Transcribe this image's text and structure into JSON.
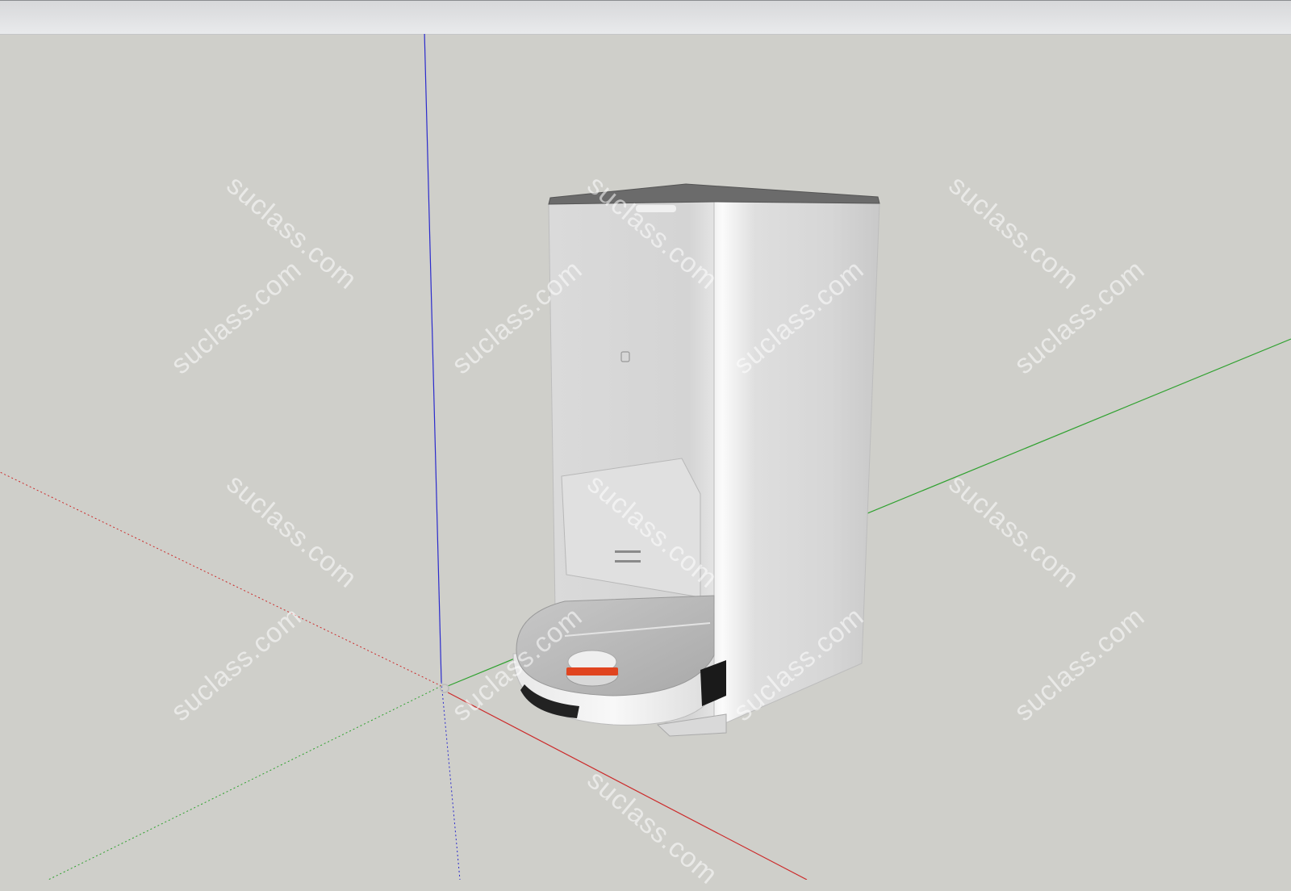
{
  "app": {
    "colors": {
      "background": "#cfcfca",
      "axis_red": "#cc2b2b",
      "axis_green": "#2fa12f",
      "axis_blue": "#2b2bcc",
      "accent_orange": "#e0441f"
    }
  },
  "scene": {
    "model": "robot-vacuum-with-auto-empty-station"
  },
  "watermarks": [
    {
      "text": "suclass.com"
    },
    {
      "text": "suclass.com"
    },
    {
      "text": "suclass.com"
    },
    {
      "text": "suclass.com"
    },
    {
      "text": "suclass.com"
    },
    {
      "text": "suclass.com"
    },
    {
      "text": "suclass.com"
    },
    {
      "text": "suclass.com"
    },
    {
      "text": "suclass.com"
    },
    {
      "text": "suclass.com"
    },
    {
      "text": "suclass.com"
    },
    {
      "text": "suclass.com"
    },
    {
      "text": "suclass.com"
    },
    {
      "text": "suclass.com"
    },
    {
      "text": "suclass.com"
    }
  ]
}
